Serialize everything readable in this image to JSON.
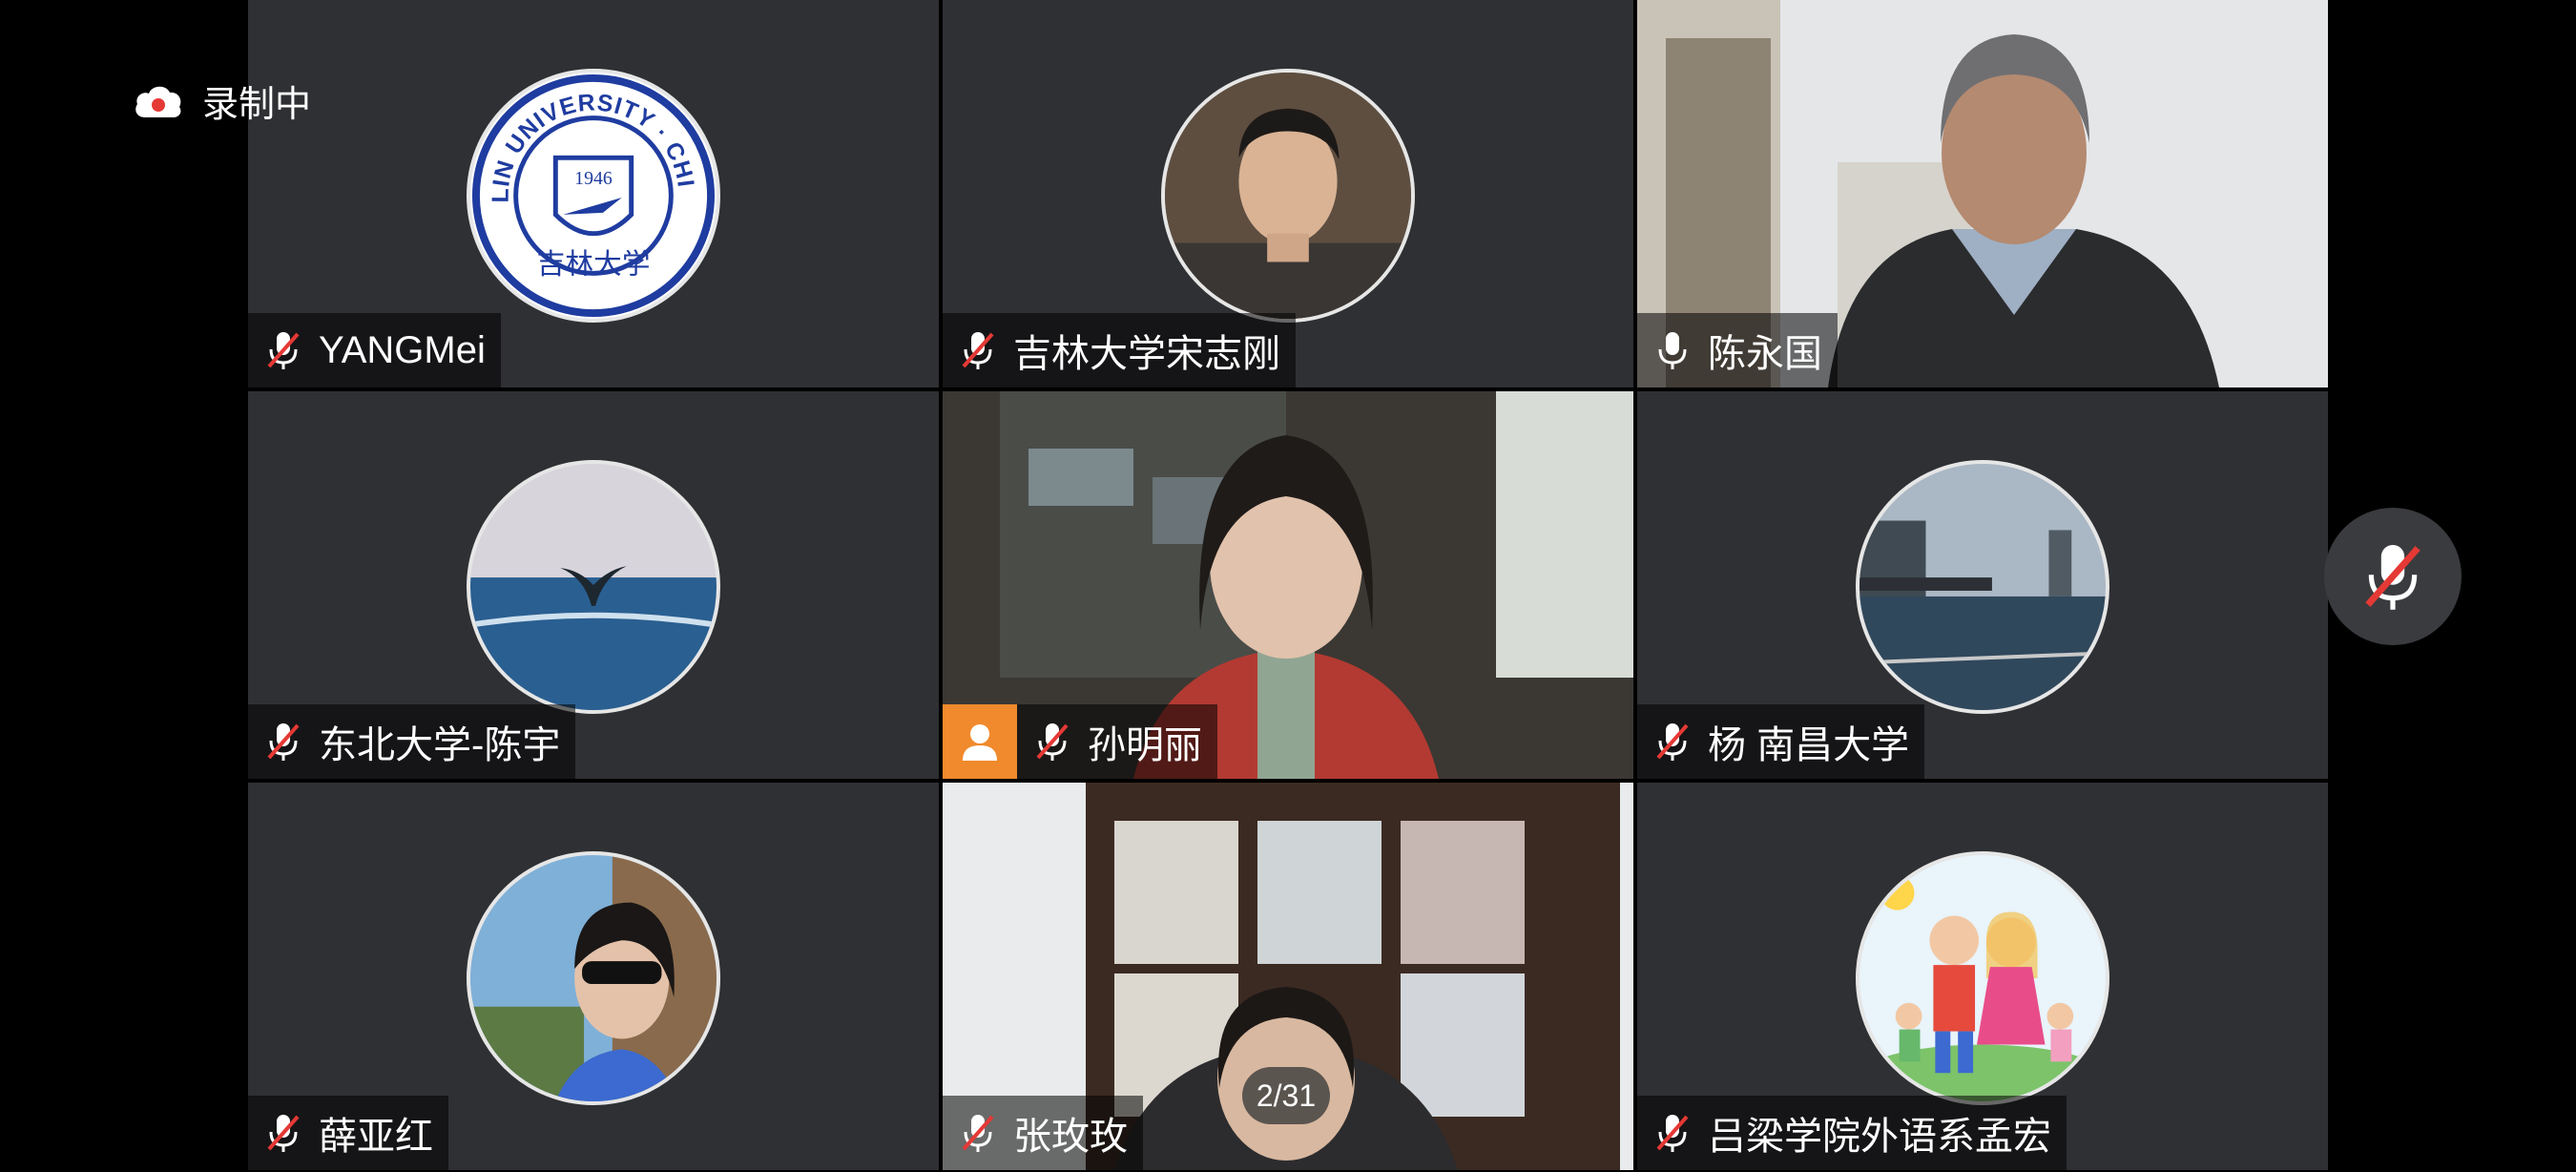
{
  "recording": {
    "label": "录制中"
  },
  "pager": {
    "label": "2/31"
  },
  "participants": [
    {
      "name": "YANGMei",
      "muted": true
    },
    {
      "name": "吉林大学宋志刚",
      "muted": true
    },
    {
      "name": "陈永国",
      "muted": false,
      "active": true
    },
    {
      "name": "东北大学-陈宇",
      "muted": true
    },
    {
      "name": "孙明丽",
      "muted": true,
      "host": true
    },
    {
      "name": "杨 南昌大学",
      "muted": true
    },
    {
      "name": "薛亚红",
      "muted": true
    },
    {
      "name": "张玫玫",
      "muted": true
    },
    {
      "name": "吕梁学院外语系孟宏",
      "muted": true
    }
  ],
  "logo_text": {
    "top": "JILIN UNIVERSITY · CHINA",
    "year": "1946",
    "bottom": "吉林大学"
  },
  "colors": {
    "tile_bg": "#2f3033",
    "active_border": "#34c759",
    "host_badge": "#f08a2c",
    "mute_slash": "#e53935"
  }
}
